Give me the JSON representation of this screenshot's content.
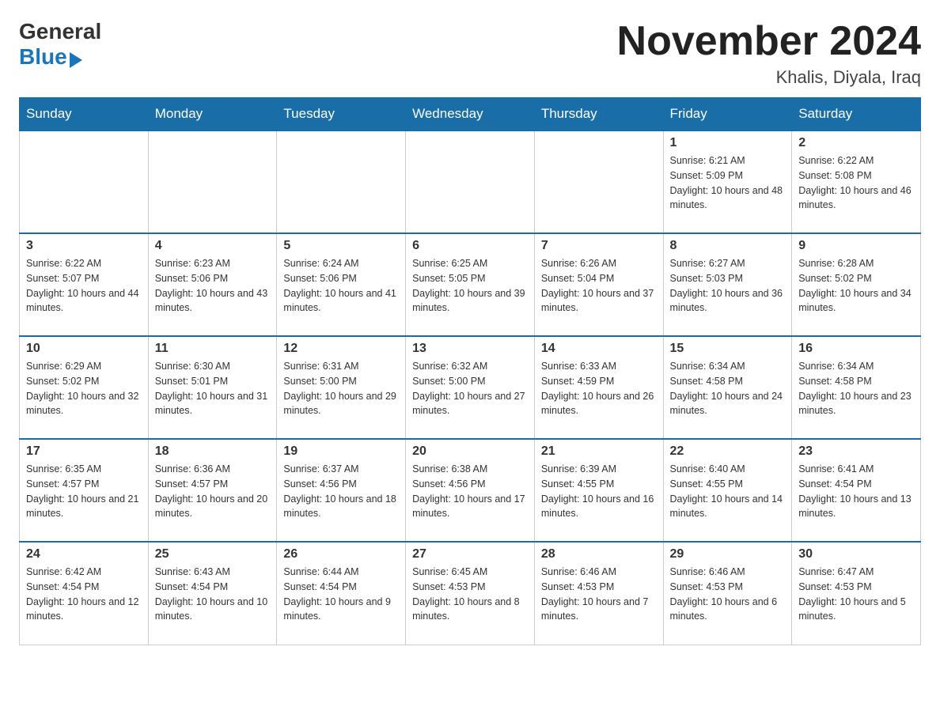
{
  "logo": {
    "general": "General",
    "blue": "Blue"
  },
  "header": {
    "title": "November 2024",
    "subtitle": "Khalis, Diyala, Iraq"
  },
  "weekdays": [
    "Sunday",
    "Monday",
    "Tuesday",
    "Wednesday",
    "Thursday",
    "Friday",
    "Saturday"
  ],
  "weeks": [
    [
      {
        "day": "",
        "info": ""
      },
      {
        "day": "",
        "info": ""
      },
      {
        "day": "",
        "info": ""
      },
      {
        "day": "",
        "info": ""
      },
      {
        "day": "",
        "info": ""
      },
      {
        "day": "1",
        "info": "Sunrise: 6:21 AM\nSunset: 5:09 PM\nDaylight: 10 hours and 48 minutes."
      },
      {
        "day": "2",
        "info": "Sunrise: 6:22 AM\nSunset: 5:08 PM\nDaylight: 10 hours and 46 minutes."
      }
    ],
    [
      {
        "day": "3",
        "info": "Sunrise: 6:22 AM\nSunset: 5:07 PM\nDaylight: 10 hours and 44 minutes."
      },
      {
        "day": "4",
        "info": "Sunrise: 6:23 AM\nSunset: 5:06 PM\nDaylight: 10 hours and 43 minutes."
      },
      {
        "day": "5",
        "info": "Sunrise: 6:24 AM\nSunset: 5:06 PM\nDaylight: 10 hours and 41 minutes."
      },
      {
        "day": "6",
        "info": "Sunrise: 6:25 AM\nSunset: 5:05 PM\nDaylight: 10 hours and 39 minutes."
      },
      {
        "day": "7",
        "info": "Sunrise: 6:26 AM\nSunset: 5:04 PM\nDaylight: 10 hours and 37 minutes."
      },
      {
        "day": "8",
        "info": "Sunrise: 6:27 AM\nSunset: 5:03 PM\nDaylight: 10 hours and 36 minutes."
      },
      {
        "day": "9",
        "info": "Sunrise: 6:28 AM\nSunset: 5:02 PM\nDaylight: 10 hours and 34 minutes."
      }
    ],
    [
      {
        "day": "10",
        "info": "Sunrise: 6:29 AM\nSunset: 5:02 PM\nDaylight: 10 hours and 32 minutes."
      },
      {
        "day": "11",
        "info": "Sunrise: 6:30 AM\nSunset: 5:01 PM\nDaylight: 10 hours and 31 minutes."
      },
      {
        "day": "12",
        "info": "Sunrise: 6:31 AM\nSunset: 5:00 PM\nDaylight: 10 hours and 29 minutes."
      },
      {
        "day": "13",
        "info": "Sunrise: 6:32 AM\nSunset: 5:00 PM\nDaylight: 10 hours and 27 minutes."
      },
      {
        "day": "14",
        "info": "Sunrise: 6:33 AM\nSunset: 4:59 PM\nDaylight: 10 hours and 26 minutes."
      },
      {
        "day": "15",
        "info": "Sunrise: 6:34 AM\nSunset: 4:58 PM\nDaylight: 10 hours and 24 minutes."
      },
      {
        "day": "16",
        "info": "Sunrise: 6:34 AM\nSunset: 4:58 PM\nDaylight: 10 hours and 23 minutes."
      }
    ],
    [
      {
        "day": "17",
        "info": "Sunrise: 6:35 AM\nSunset: 4:57 PM\nDaylight: 10 hours and 21 minutes."
      },
      {
        "day": "18",
        "info": "Sunrise: 6:36 AM\nSunset: 4:57 PM\nDaylight: 10 hours and 20 minutes."
      },
      {
        "day": "19",
        "info": "Sunrise: 6:37 AM\nSunset: 4:56 PM\nDaylight: 10 hours and 18 minutes."
      },
      {
        "day": "20",
        "info": "Sunrise: 6:38 AM\nSunset: 4:56 PM\nDaylight: 10 hours and 17 minutes."
      },
      {
        "day": "21",
        "info": "Sunrise: 6:39 AM\nSunset: 4:55 PM\nDaylight: 10 hours and 16 minutes."
      },
      {
        "day": "22",
        "info": "Sunrise: 6:40 AM\nSunset: 4:55 PM\nDaylight: 10 hours and 14 minutes."
      },
      {
        "day": "23",
        "info": "Sunrise: 6:41 AM\nSunset: 4:54 PM\nDaylight: 10 hours and 13 minutes."
      }
    ],
    [
      {
        "day": "24",
        "info": "Sunrise: 6:42 AM\nSunset: 4:54 PM\nDaylight: 10 hours and 12 minutes."
      },
      {
        "day": "25",
        "info": "Sunrise: 6:43 AM\nSunset: 4:54 PM\nDaylight: 10 hours and 10 minutes."
      },
      {
        "day": "26",
        "info": "Sunrise: 6:44 AM\nSunset: 4:54 PM\nDaylight: 10 hours and 9 minutes."
      },
      {
        "day": "27",
        "info": "Sunrise: 6:45 AM\nSunset: 4:53 PM\nDaylight: 10 hours and 8 minutes."
      },
      {
        "day": "28",
        "info": "Sunrise: 6:46 AM\nSunset: 4:53 PM\nDaylight: 10 hours and 7 minutes."
      },
      {
        "day": "29",
        "info": "Sunrise: 6:46 AM\nSunset: 4:53 PM\nDaylight: 10 hours and 6 minutes."
      },
      {
        "day": "30",
        "info": "Sunrise: 6:47 AM\nSunset: 4:53 PM\nDaylight: 10 hours and 5 minutes."
      }
    ]
  ]
}
